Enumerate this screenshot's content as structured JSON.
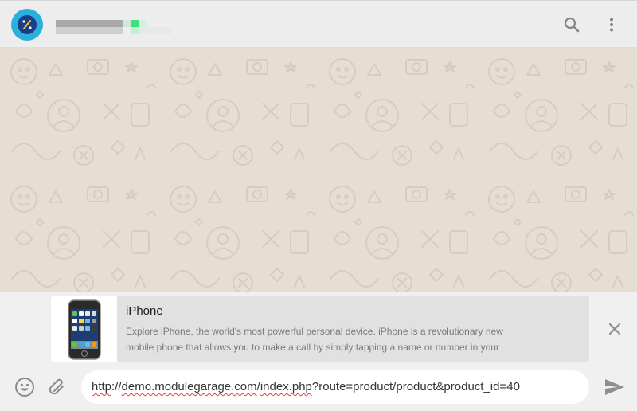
{
  "header": {
    "avatar": {
      "icon": "app-logo-icon",
      "bg_color": "#2bb0dc",
      "inner_color": "#1b3f86"
    },
    "contact_name_redacted": true,
    "icons": [
      "search-icon",
      "more-vert-icon"
    ]
  },
  "chat": {
    "background_color": "#e6ded3",
    "pattern": "doodle-wallpaper"
  },
  "link_preview": {
    "title": "iPhone",
    "description_line1": "Explore iPhone, the world's most powerful personal device. iPhone is a revolutionary new",
    "description_line2": "mobile phone that allows you to make a call by simply tapping a name or number in your",
    "thumbnail": "iphone-image",
    "close_icon": "close-icon"
  },
  "composer": {
    "message_text_parts": {
      "scheme": "http",
      "sep1": "://",
      "domain": "demo.modulegarage.com",
      "sep2": "/",
      "path": "index.php",
      "query": "?route=product/product&product_id=40"
    },
    "icons": [
      "emoji-icon",
      "attach-icon",
      "send-icon"
    ],
    "spellcheck_underline_color": "#e0443c"
  }
}
